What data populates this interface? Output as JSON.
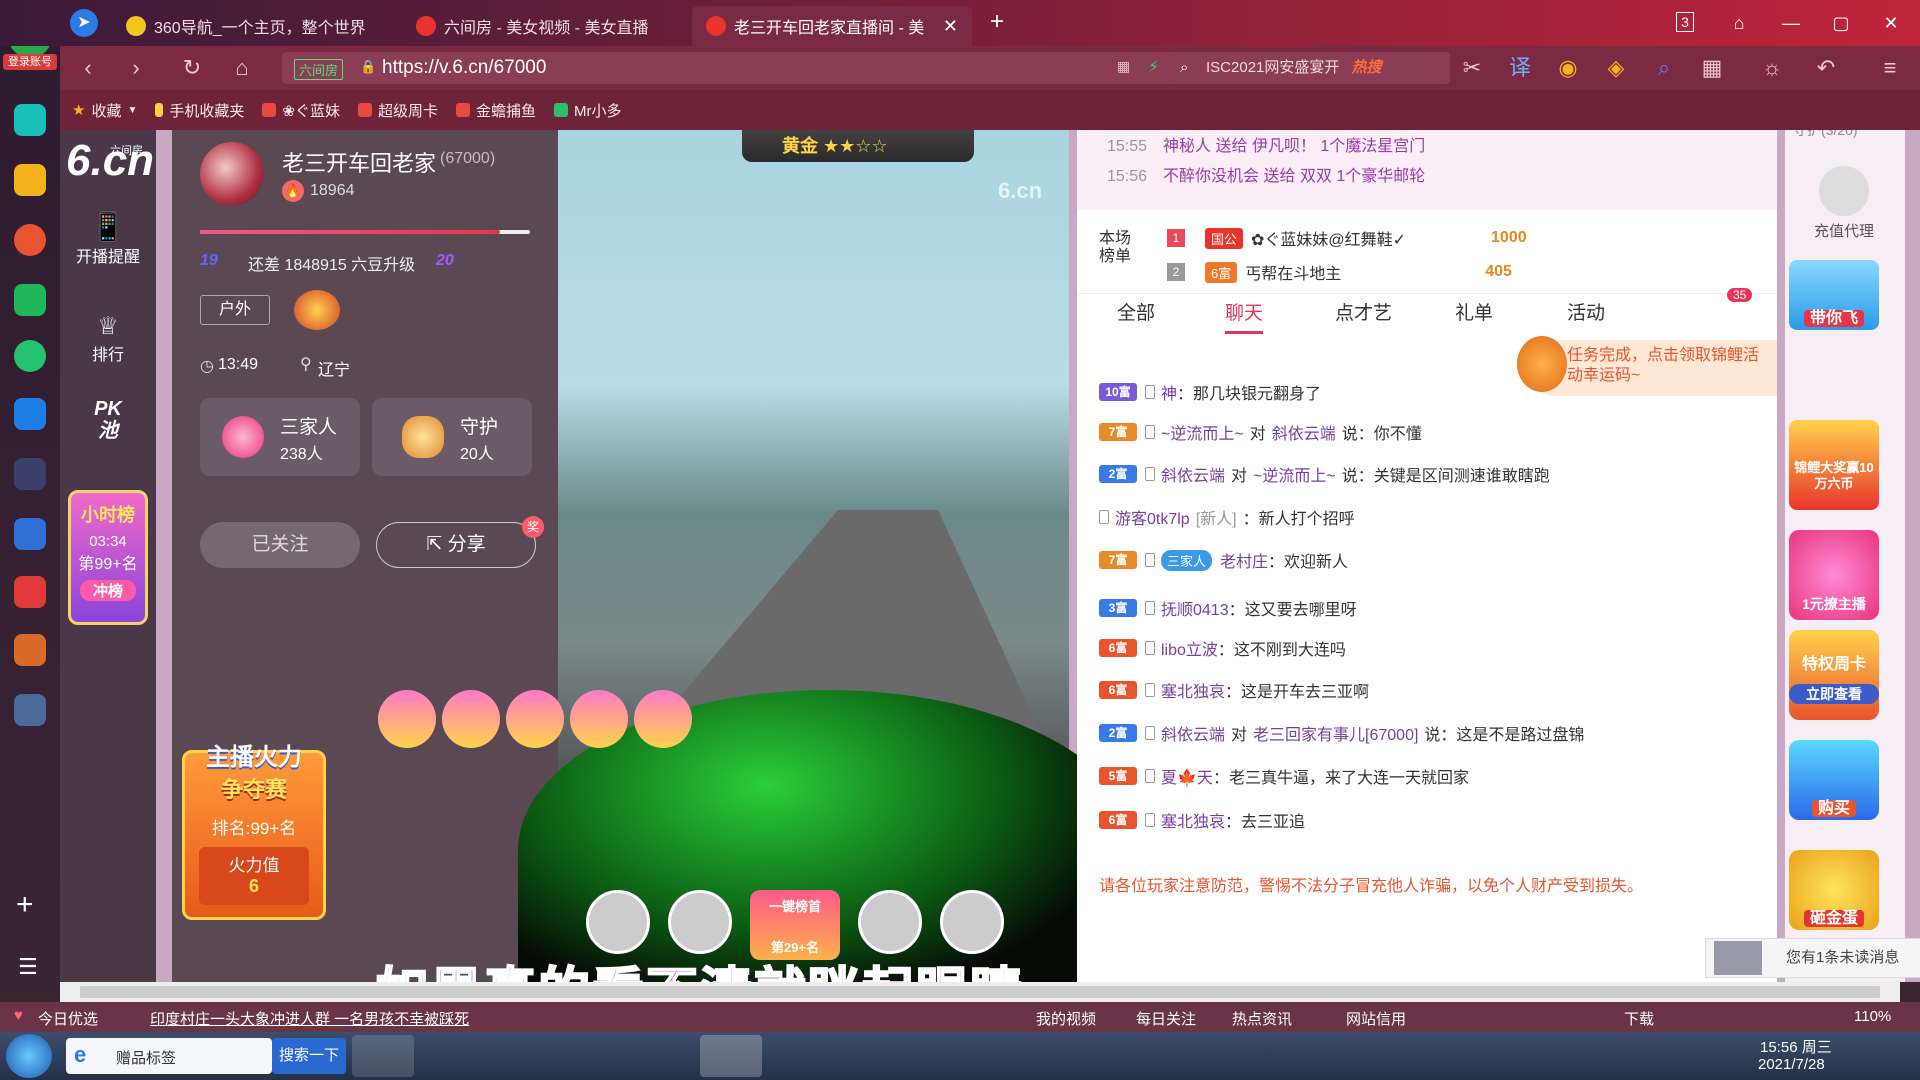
{
  "browser": {
    "login_label": "登录账号",
    "tabs": [
      {
        "title": "360导航_一个主页，整个世界"
      },
      {
        "title": "六间房 - 美女视频 - 美女直播"
      },
      {
        "title": "老三开车回老家直播间 - 美女"
      }
    ],
    "tab_count": "3",
    "url_badge": "六间房",
    "url": "https://v.6.cn/67000",
    "search_placeholder": "ISC2021网安盛宴开",
    "hot_label": "热搜",
    "bookmarks": [
      {
        "label": "收藏"
      },
      {
        "label": "手机收藏夹"
      },
      {
        "label": "❀ぐ蓝妹"
      },
      {
        "label": "超级周卡"
      },
      {
        "label": "金蟾捕鱼"
      },
      {
        "label": "Mr小多"
      }
    ]
  },
  "site": {
    "logo": "6.cn",
    "logo_sub": "六间房",
    "nav": [
      {
        "label": "开播提醒"
      },
      {
        "label": "排行"
      },
      {
        "label": "PK池"
      }
    ],
    "hour_rank": {
      "title": "小时榜",
      "time": "03:34",
      "rank": "第99+名",
      "button": "冲榜"
    }
  },
  "streamer": {
    "name": "老三开车回老家",
    "room_id": "(67000)",
    "fans": "18964",
    "level_text": "还差 1848915 六豆升级",
    "level_from": "19",
    "level_to": "20",
    "tag": "户外",
    "time": "13:49",
    "location": "辽宁",
    "family_label": "三家人",
    "family_count": "238人",
    "guard_label": "守护",
    "guard_count": "20人",
    "follow_button": "已关注",
    "share_button": "分享",
    "fire": {
      "title1": "主播火力",
      "title2": "争夺赛",
      "rank": "排名:99+名",
      "value_label": "火力值",
      "value": "6"
    }
  },
  "video": {
    "badge": "黄金",
    "watermark": "6.cn",
    "subtitle": "如果真的看不清就眯起眼睛",
    "one_click": "一键榜首",
    "rank_tag": "第29+名"
  },
  "chat": {
    "gift_log": [
      {
        "time": "15:55",
        "text": "神秘人 送给 伊凡呗！ 1个魔法星宫门"
      },
      {
        "time": "15:56",
        "text": "不醉你没机会 送给 双双 1个豪华邮轮"
      }
    ],
    "board_title": "本场榜单",
    "board": [
      {
        "rank": "1",
        "badge": "国公",
        "name": "✿ぐ蓝妹妹@红舞鞋✓",
        "score": "1000"
      },
      {
        "rank": "2",
        "badge": "6富",
        "name": "丐帮在斗地主",
        "score": "405"
      }
    ],
    "tabs": [
      {
        "label": "全部"
      },
      {
        "label": "聊天"
      },
      {
        "label": "点才艺"
      },
      {
        "label": "礼单"
      },
      {
        "label": "活动"
      }
    ],
    "tab_badge": "35",
    "task_tip": "任务完成，点击领取锦鲤活动幸运码~",
    "messages": [
      {
        "badge": "10富",
        "user": "神",
        "text": "：那几块银元翻身了"
      },
      {
        "badge": "7富",
        "user": "~逆流而上~",
        "mid": "对",
        "target": "斜依云端",
        "text": "说：你不懂"
      },
      {
        "badge": "2富",
        "user": "斜依云端",
        "mid": "对",
        "target": "~逆流而上~",
        "text": "说：关键是区间测速谁敢瞎跑"
      },
      {
        "badge": "",
        "user": "游客0tk7lp",
        "mid": "[新人]",
        "text": "：新人打个招呼"
      },
      {
        "badge": "7富",
        "fam": "三家人",
        "user": "老村庄",
        "text": "：欢迎新人"
      },
      {
        "badge": "3富",
        "user": "抚顺0413",
        "text": "：这又要去哪里呀"
      },
      {
        "badge": "6富",
        "user": "libo立波",
        "text": "：这不刚到大连吗"
      },
      {
        "badge": "6富",
        "user": "塞北独哀",
        "text": "：这是开车去三亚啊"
      },
      {
        "badge": "2富",
        "user": "斜依云端",
        "mid": "对",
        "target": "老三回家有事儿[67000]",
        "text": "说：这是不是路过盘锦"
      },
      {
        "badge": "5富",
        "user": "夏🍁天",
        "text": "：老三真牛逼，来了大连一天就回家"
      },
      {
        "badge": "6富",
        "user": "塞北独哀",
        "text": "：去三亚追"
      }
    ],
    "notice": "请各位玩家注意防范，警惕不法分子冒充他人诈骗，以免个人财产受到损失。",
    "unread": "您有1条未读消息"
  },
  "right": {
    "guard_title": "守护(3/20)",
    "items": [
      {
        "label": "充值代理"
      },
      {
        "label": "带你飞"
      },
      {
        "label": "锦鲤大奖赢10万六币"
      },
      {
        "label": "1元撩主播"
      },
      {
        "label": "特权周卡"
      },
      {
        "label": "立即查看"
      },
      {
        "label": "购买"
      },
      {
        "label": "砸金蛋"
      }
    ]
  },
  "status": {
    "left": "今日优选",
    "news": "印度村庄一头大象冲进人群 一名男孩不幸被踩死",
    "items": [
      {
        "label": "我的视频"
      },
      {
        "label": "每日关注"
      },
      {
        "label": "热点资讯"
      },
      {
        "label": "网站信用"
      },
      {
        "label": "下载"
      }
    ],
    "zoom": "110%"
  },
  "taskbar": {
    "ie_label": "赠品标签",
    "search_btn": "搜索一下",
    "time": "15:56 周三",
    "date": "2021/7/28"
  }
}
